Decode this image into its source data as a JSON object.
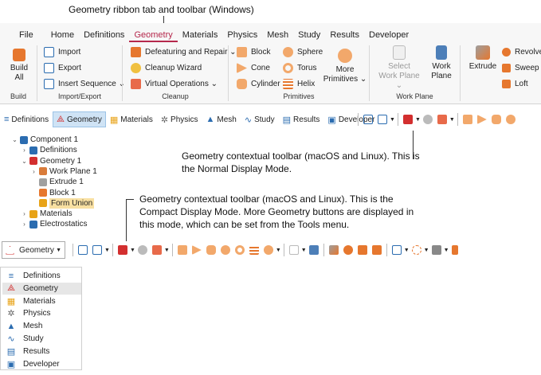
{
  "captions": {
    "ribbon": "Geometry ribbon tab and toolbar (Windows)",
    "normal_1": "Geometry contextual toolbar (macOS and Linux). This is",
    "normal_2": "the Normal Display Mode.",
    "compact_1": "Geometry contextual toolbar (macOS and Linux). This is the",
    "compact_2": "Compact Display Mode. More Geometry buttons are displayed in",
    "compact_3": "this mode, which can be set from the Tools menu."
  },
  "ribbon": {
    "tabs": [
      "File",
      "Home",
      "Definitions",
      "Geometry",
      "Materials",
      "Physics",
      "Mesh",
      "Study",
      "Results",
      "Developer"
    ],
    "active_tab": "Geometry",
    "build": {
      "label": "Build\nAll",
      "group": "Build"
    },
    "import_export": {
      "items": [
        "Import",
        "Export",
        "Insert Sequence ⌄"
      ],
      "group": "Import/Export"
    },
    "cleanup": {
      "items": [
        "Defeaturing and Repair ⌄",
        "Cleanup Wizard",
        "Virtual Operations ⌄"
      ],
      "group": "Cleanup"
    },
    "primitives": {
      "col1": [
        "Block",
        "Cone",
        "Cylinder"
      ],
      "col2": [
        "Sphere",
        "Torus",
        "Helix"
      ],
      "more": "More\nPrimitives ⌄",
      "group": "Primitives"
    },
    "workplane": {
      "select": "Select\nWork Plane ⌄",
      "work": "Work\nPlane",
      "group": "Work Plane"
    },
    "extrude": "Extrude",
    "ops": [
      "Revolve",
      "Sweep",
      "Loft"
    ]
  },
  "toolbar": {
    "items": [
      "Definitions",
      "Geometry",
      "Materials",
      "Physics",
      "Mesh",
      "Study",
      "Results",
      "Developer"
    ],
    "active": "Geometry"
  },
  "tree": [
    {
      "label": "Component 1",
      "arrow": "⌄"
    },
    {
      "label": "Definitions",
      "arrow": "›"
    },
    {
      "label": "Geometry 1",
      "arrow": "⌄"
    },
    {
      "label": "Work Plane 1",
      "arrow": "›"
    },
    {
      "label": "Extrude 1",
      "arrow": ""
    },
    {
      "label": "Block 1",
      "arrow": ""
    },
    {
      "label": "Form Union",
      "arrow": ""
    },
    {
      "label": "Materials",
      "arrow": "›"
    },
    {
      "label": "Electrostatics",
      "arrow": "›"
    }
  ],
  "compact": {
    "dropdown": "Geometry",
    "menu": [
      "Definitions",
      "Geometry",
      "Materials",
      "Physics",
      "Mesh",
      "Study",
      "Results",
      "Developer"
    ],
    "selected": "Geometry"
  },
  "colors": {
    "accent": "#b5284c",
    "ribbon_bg": "#f7f7f7",
    "selected_bg": "#cfe3f5",
    "tree_sel": "#f8e0a2",
    "red": "#d32f2f",
    "orange": "#e6772e",
    "blue": "#2b6cb0"
  }
}
